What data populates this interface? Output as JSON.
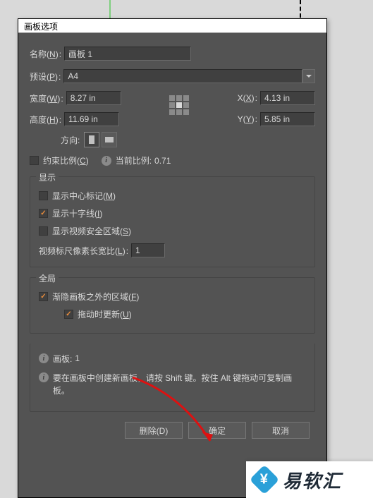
{
  "dialog_title": "画板选项",
  "name": {
    "label": "名称",
    "hotkey": "N",
    "value": "画板 1"
  },
  "preset": {
    "label": "预设",
    "hotkey": "P",
    "value": "A4"
  },
  "width": {
    "label": "宽度",
    "hotkey": "W",
    "value": "8.27 in"
  },
  "height": {
    "label": "高度",
    "hotkey": "H",
    "value": "11.69 in"
  },
  "x": {
    "label": "X",
    "hotkey": "X",
    "value": "4.13 in"
  },
  "y": {
    "label": "Y",
    "hotkey": "Y",
    "value": "5.85 in"
  },
  "orientation_label": "方向:",
  "constrain": {
    "label": "约束比例",
    "hotkey": "C",
    "checked": false
  },
  "current_ratio": {
    "label": "当前比例:",
    "value": "0.71"
  },
  "display_group": "显示",
  "show_center": {
    "label": "显示中心标记",
    "hotkey": "M",
    "checked": false
  },
  "show_cross": {
    "label": "显示十字线",
    "hotkey": "I",
    "checked": true
  },
  "show_safe": {
    "label": "显示视频安全区域",
    "hotkey": "S",
    "checked": false
  },
  "video_par": {
    "label": "视频标尺像素长宽比",
    "hotkey": "L",
    "value": "1"
  },
  "global_group": "全局",
  "fade_region": {
    "label": "渐隐画板之外的区域",
    "hotkey": "F",
    "checked": true
  },
  "update_drag": {
    "label": "拖动时更新",
    "hotkey": "U",
    "checked": true
  },
  "artboard_count": {
    "label": "画板:",
    "value": "1"
  },
  "hint": "要在画板中创建新画板，请按 Shift 键。按住 Alt 键拖动可复制画板。",
  "buttons": {
    "delete": "删除(D)",
    "ok": "确定",
    "cancel": "取消"
  },
  "logo_text": "易软汇"
}
